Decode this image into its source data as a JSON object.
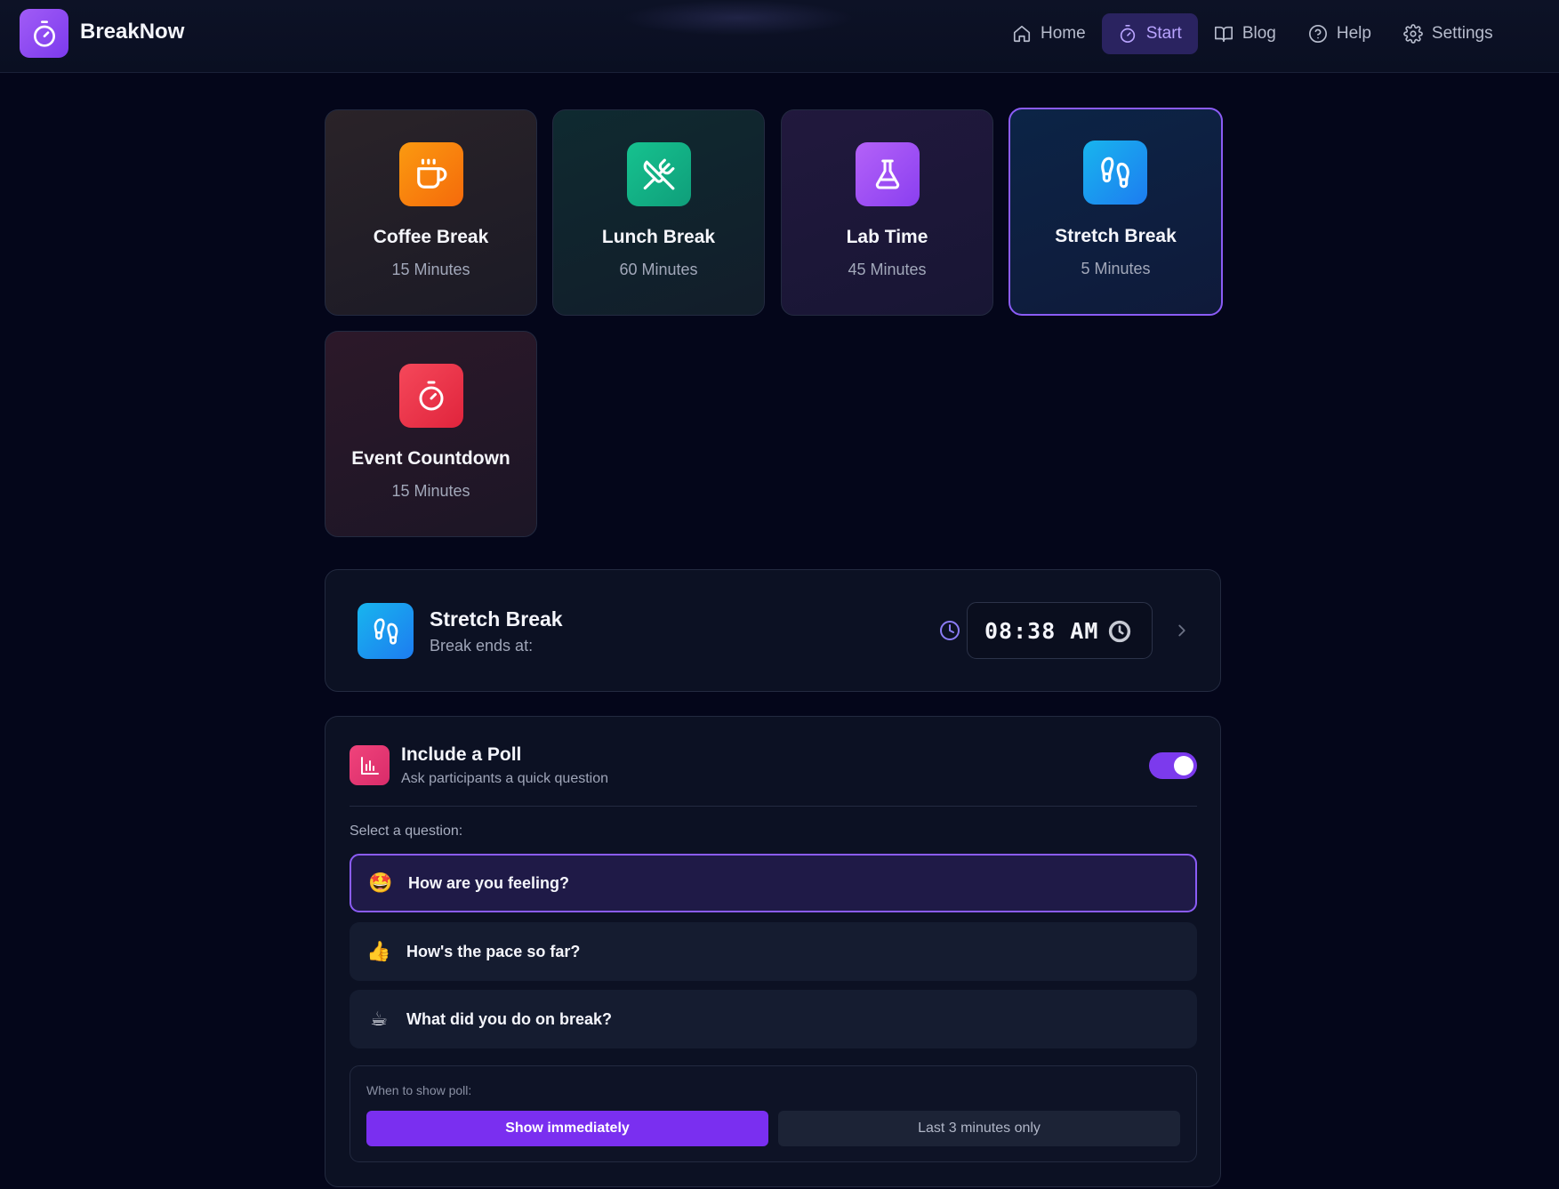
{
  "app": {
    "name": "BreakNow"
  },
  "nav": [
    {
      "label": "Home",
      "icon": "home-icon"
    },
    {
      "label": "Start",
      "icon": "timer-icon",
      "active": true
    },
    {
      "label": "Blog",
      "icon": "book-icon"
    },
    {
      "label": "Help",
      "icon": "help-circle-icon"
    },
    {
      "label": "Settings",
      "icon": "gear-icon"
    }
  ],
  "presets": [
    {
      "title": "Coffee Break",
      "duration": "15 Minutes",
      "icon": "coffee-cup-icon",
      "color": "#f97316"
    },
    {
      "title": "Lunch Break",
      "duration": "60 Minutes",
      "icon": "utensils-icon",
      "color": "#10b981"
    },
    {
      "title": "Lab Time",
      "duration": "45 Minutes",
      "icon": "flask-icon",
      "color": "#a855f7"
    },
    {
      "title": "Stretch Break",
      "duration": "5 Minutes",
      "icon": "footprints-icon",
      "color": "#0ea5e9",
      "selected": true
    },
    {
      "title": "Event Countdown",
      "duration": "15 Minutes",
      "icon": "timer-icon",
      "color": "#ef4444"
    }
  ],
  "summary": {
    "title": "Stretch Break",
    "subtitle": "Break ends at:",
    "end_time": "08:38 AM"
  },
  "poll": {
    "title": "Include a Poll",
    "subtitle": "Ask participants a quick question",
    "enabled": true,
    "question_label": "Select a question:",
    "questions": [
      {
        "emoji": "🤩",
        "text": "How are you feeling?",
        "selected": true
      },
      {
        "emoji": "👍",
        "text": "How's the pace so far?"
      },
      {
        "emoji": "☕",
        "text": "What did you do on break?"
      }
    ],
    "when_label": "When to show poll:",
    "when_options": [
      {
        "label": "Show immediately",
        "selected": true
      },
      {
        "label": "Last 3 minutes only"
      }
    ]
  },
  "colors": {
    "accent": "#7c3aed",
    "background": "#04061a"
  }
}
